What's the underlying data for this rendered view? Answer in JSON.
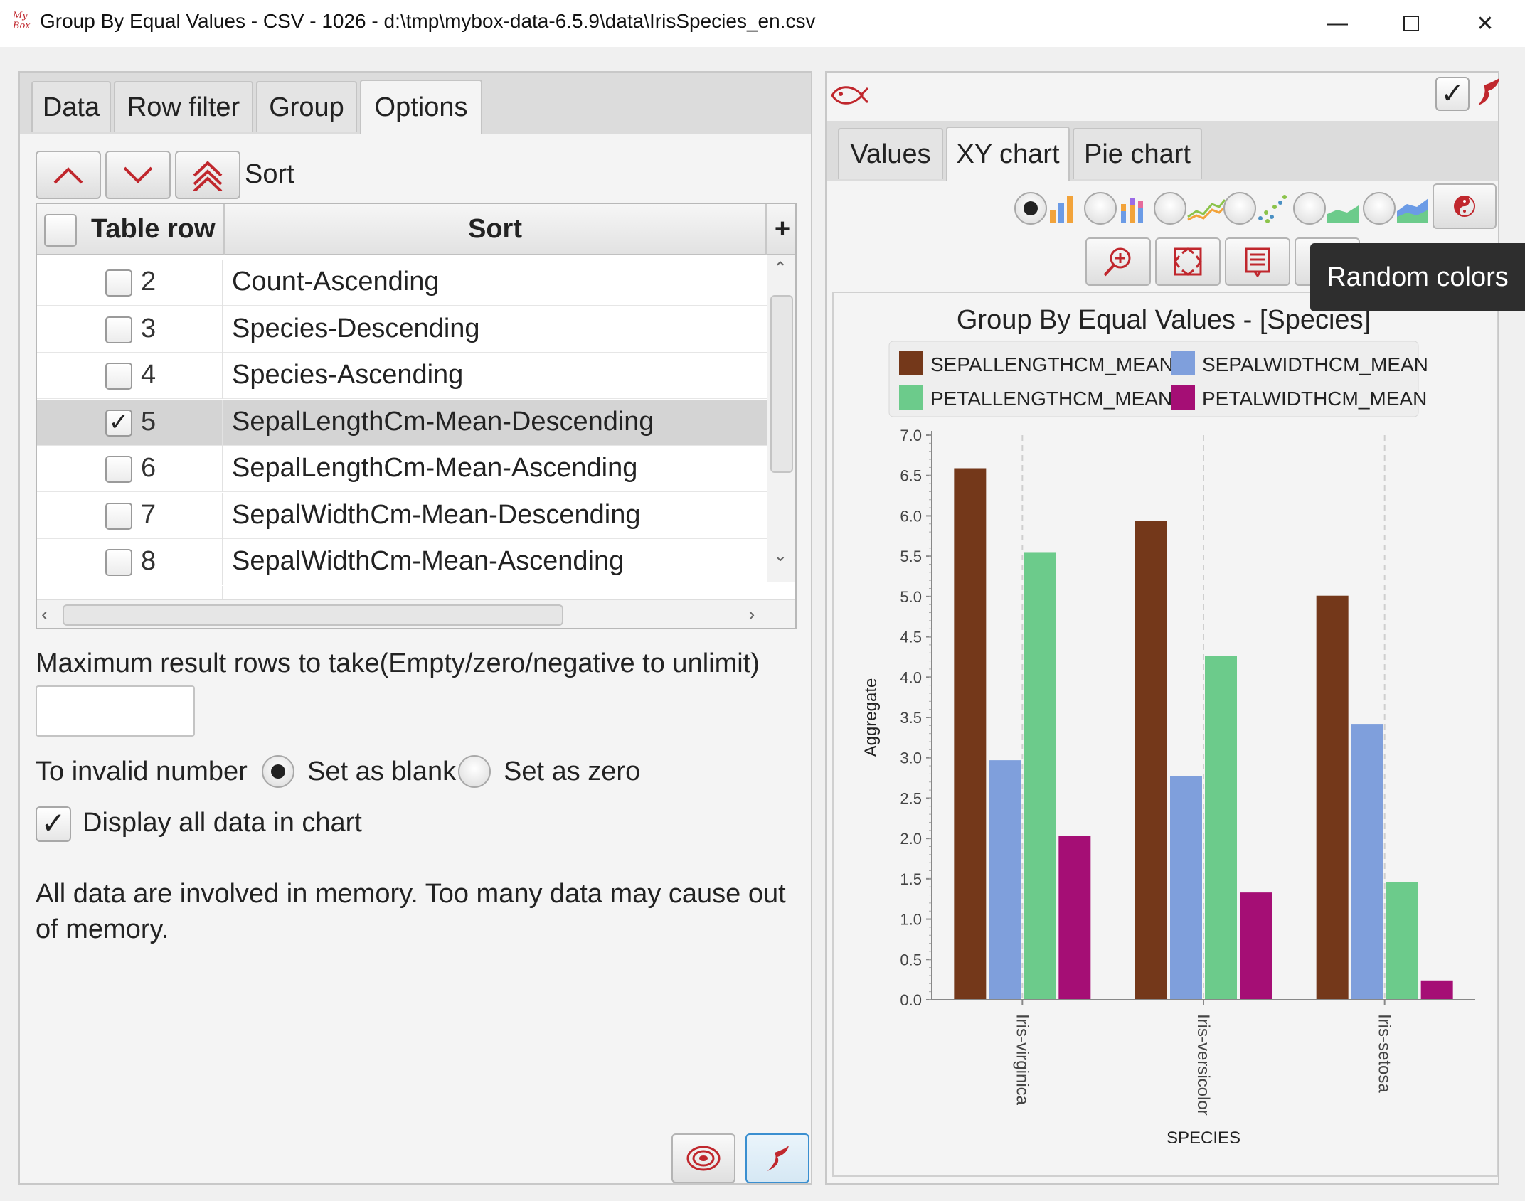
{
  "window": {
    "app_icon_text": "My Box",
    "title": "Group By Equal Values - CSV - 1026 - d:\\tmp\\mybox-data-6.5.9\\data\\IrisSpecies_en.csv"
  },
  "left": {
    "tabs": [
      "Data",
      "Row filter",
      "Group",
      "Options"
    ],
    "active_tab": "Options",
    "sort_label": "Sort",
    "table": {
      "headers": [
        "Table row",
        "Sort"
      ],
      "rows": [
        {
          "num": "2",
          "sort": "Count-Ascending",
          "checked": false
        },
        {
          "num": "3",
          "sort": "Species-Descending",
          "checked": false
        },
        {
          "num": "4",
          "sort": "Species-Ascending",
          "checked": false
        },
        {
          "num": "5",
          "sort": "SepalLengthCm-Mean-Descending",
          "checked": true
        },
        {
          "num": "6",
          "sort": "SepalLengthCm-Mean-Ascending",
          "checked": false
        },
        {
          "num": "7",
          "sort": "SepalWidthCm-Mean-Descending",
          "checked": false
        },
        {
          "num": "8",
          "sort": "SepalWidthCm-Mean-Ascending",
          "checked": false
        }
      ]
    },
    "max_rows_label": "Maximum result rows to take(Empty/zero/negative to unlimit)",
    "max_rows_value": "",
    "invalid_label": "To invalid number",
    "opt_blank": "Set as blank",
    "opt_zero": "Set as zero",
    "invalid_selected": "Set as blank",
    "display_all_label": "Display all data in chart",
    "display_all_checked": true,
    "memory_note": "All data are involved in memory. Too many data may cause out of memory."
  },
  "right": {
    "tabs": [
      "Values",
      "XY chart",
      "Pie chart"
    ],
    "active_tab": "XY chart",
    "tooltip": "Random colors",
    "chart_types": [
      "bar",
      "stacked-bar",
      "line",
      "scatter",
      "area",
      "stacked-area"
    ],
    "selected_chart_type": "bar"
  },
  "chart_data": {
    "type": "bar",
    "title": "Group By Equal Values - [Species]",
    "xlabel": "SPECIES",
    "ylabel": "Aggregate",
    "categories": [
      "Iris-virginica",
      "Iris-versicolor",
      "Iris-setosa"
    ],
    "ylim": [
      0,
      7
    ],
    "yticks": [
      "0.0",
      "0.5",
      "1.0",
      "1.5",
      "2.0",
      "2.5",
      "3.0",
      "3.5",
      "4.0",
      "4.5",
      "5.0",
      "5.5",
      "6.0",
      "6.5",
      "7.0"
    ],
    "legend_position": "top",
    "grid": true,
    "series": [
      {
        "name": "SEPALLENGTHCM_MEAN",
        "color": "#74381a",
        "values": [
          6.59,
          5.94,
          5.01
        ]
      },
      {
        "name": "SEPALWIDTHCM_MEAN",
        "color": "#7f9fdc",
        "values": [
          2.97,
          2.77,
          3.42
        ]
      },
      {
        "name": "PETALLENGTHCM_MEAN",
        "color": "#6ccb8b",
        "values": [
          5.55,
          4.26,
          1.46
        ]
      },
      {
        "name": "PETALWIDTHCM_MEAN",
        "color": "#a50e75",
        "values": [
          2.03,
          1.33,
          0.24
        ]
      }
    ]
  },
  "colors": {
    "accent": "#c0272d",
    "selection": "#d4d4d4"
  }
}
